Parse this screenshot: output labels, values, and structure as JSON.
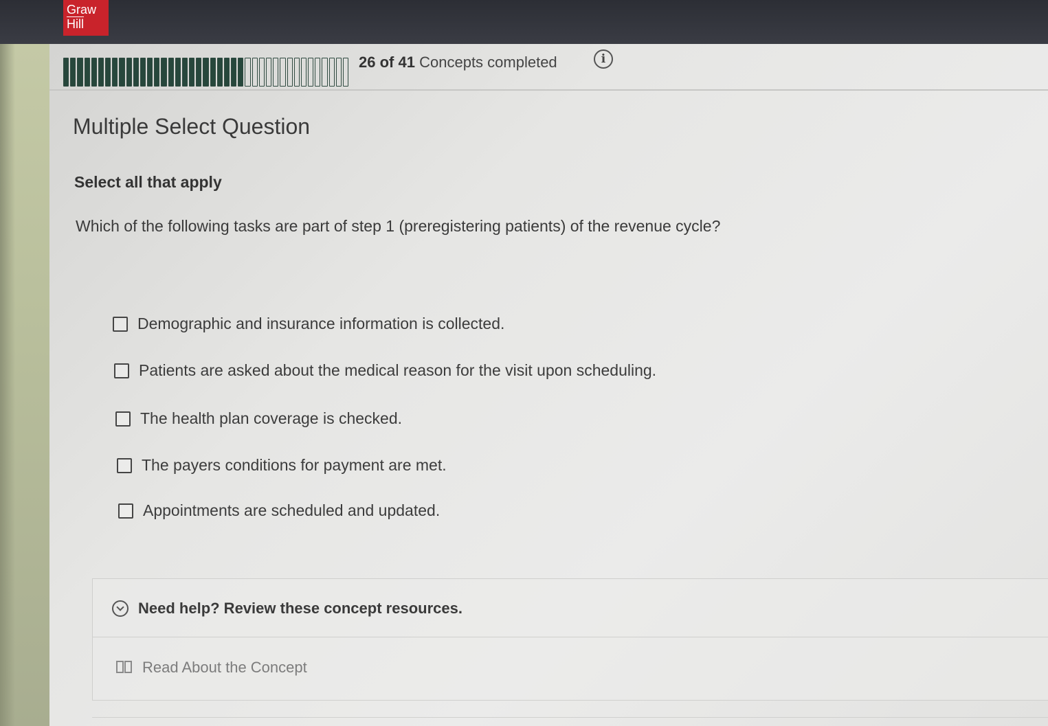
{
  "brand": {
    "logo_line1": "Graw",
    "logo_line2": "Hill",
    "color": "#c9232b"
  },
  "progress": {
    "completed": 26,
    "total": 41,
    "fraction": 0.634,
    "completed_label": "26",
    "of_label": "of",
    "total_label": "41",
    "suffix": "Concepts completed",
    "info_icon": "info-icon",
    "bar_color": "#27473c"
  },
  "question": {
    "type": "Multiple Select Question",
    "instruction": "Select all that apply",
    "prompt": "Which of the following tasks are part of step 1 (preregistering patients) of the revenue cycle?",
    "options": [
      "Demographic and insurance information is collected.",
      "Patients are asked about the medical reason for the visit upon scheduling.",
      "The health plan coverage is checked.",
      "The payers conditions for payment are met.",
      "Appointments are scheduled and updated."
    ]
  },
  "help": {
    "header": "Need help? Review these concept resources.",
    "header_icon": "chevron-down-circle-icon",
    "resource_label": "Read About the Concept",
    "resource_icon": "book-icon"
  }
}
